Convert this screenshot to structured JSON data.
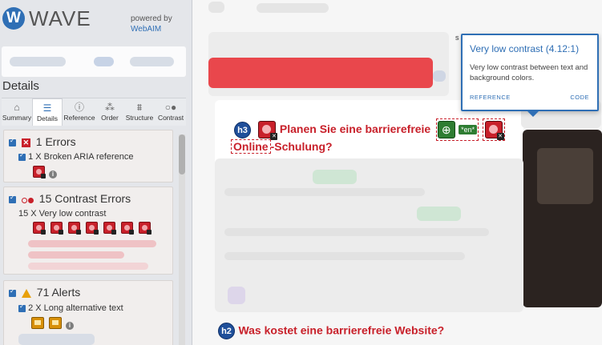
{
  "colors": {
    "accent": "#2f6fb5",
    "error": "#c8202a",
    "alert": "#e8a00a",
    "lang": "#2e7d32",
    "heading_badge": "#1f4f9a"
  },
  "sidebar": {
    "logo_letter": "W",
    "logo_text": "WAVE",
    "powered_by": "powered by",
    "webaim": "WebAIM",
    "details_title": "Details",
    "tabs": [
      {
        "label": "Summary",
        "icon": "home-icon",
        "glyph": "⌂"
      },
      {
        "label": "Details",
        "icon": "list-icon",
        "glyph": "☰"
      },
      {
        "label": "Reference",
        "icon": "info-icon",
        "glyph": "ⓘ"
      },
      {
        "label": "Order",
        "icon": "order-icon",
        "glyph": "⁂"
      },
      {
        "label": "Structure",
        "icon": "structure-icon",
        "glyph": "⩩"
      },
      {
        "label": "Contrast",
        "icon": "contrast-icon",
        "glyph": "○●"
      }
    ],
    "errors": {
      "title": "1 Errors",
      "item": "1 X Broken ARIA reference"
    },
    "contrast": {
      "title": "15 Contrast Errors",
      "item": "15 X Very low contrast"
    },
    "alerts": {
      "title": "71 Alerts",
      "item": "2 X Long alternative text"
    }
  },
  "content": {
    "heading1_level": "h3",
    "heading1_line1": "Planen Sie eine barrierefreie",
    "heading1_online": "Online",
    "heading1_line2": "-Schulung?",
    "lang_badge": "*en*",
    "heading2_level": "h2",
    "heading2_text": "Was kostet eine barrierefreie Website?",
    "badge_fragment": "s"
  },
  "tooltip": {
    "title": "Very low contrast (4.12:1)",
    "description": "Very low contrast between text and background colors.",
    "reference_link": "REFERENCE",
    "code_link": "CODE"
  }
}
